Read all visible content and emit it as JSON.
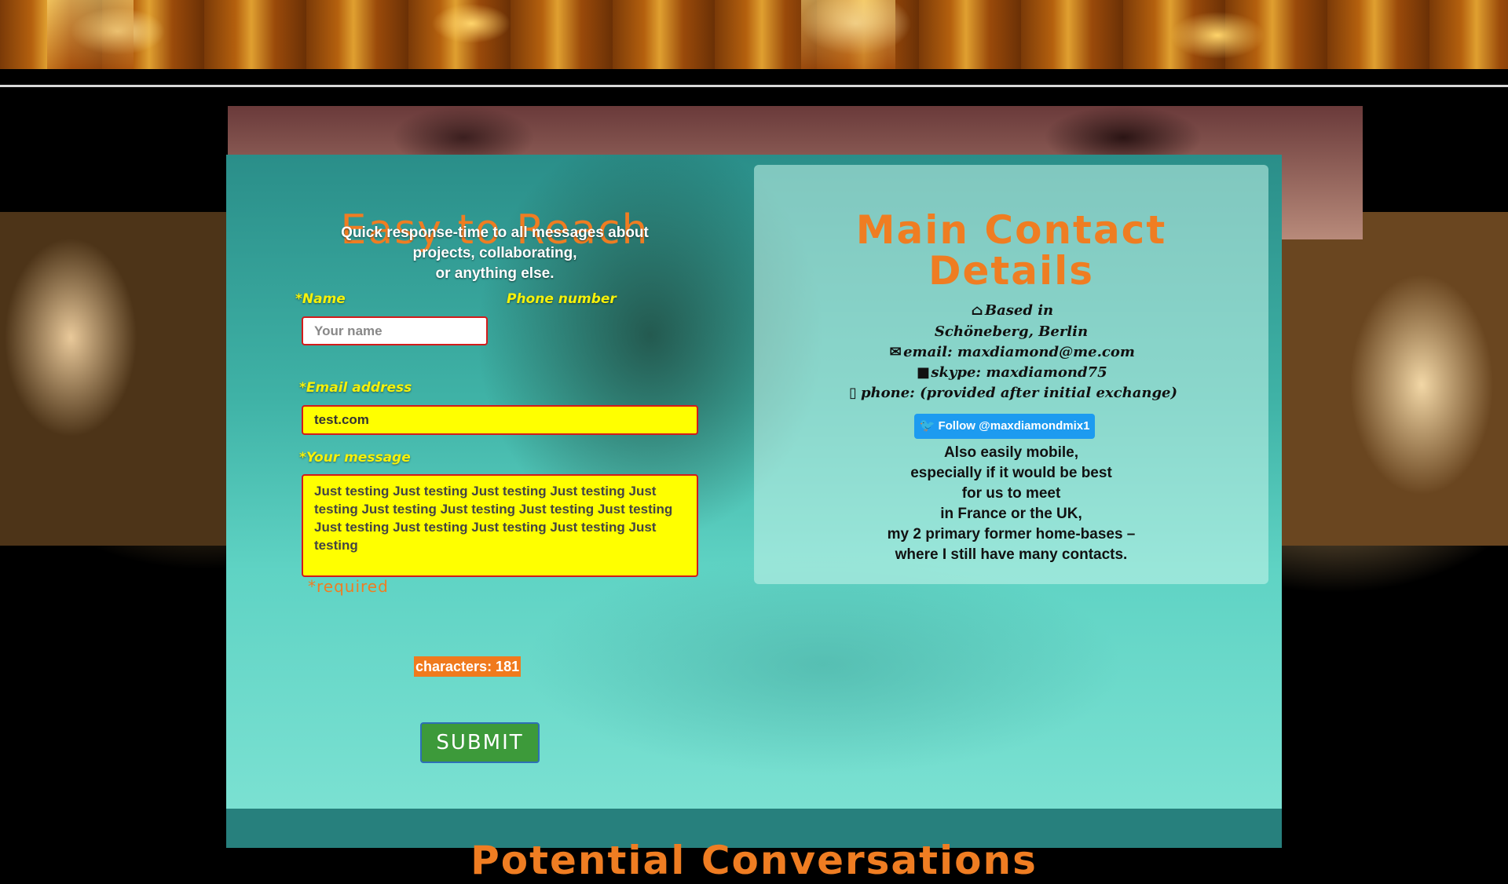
{
  "left": {
    "title": "Easy to Reach",
    "tagline": [
      "Quick response-time to all messages about",
      "projects, collaborating,",
      "or anything else."
    ],
    "name_label": "*Name",
    "name_placeholder": "Your name",
    "phone_label": "Phone number",
    "email_label": "*Email address",
    "email_value": "test.com",
    "message_label": "*Your message",
    "message_value": "Just testing Just testing Just testing Just testing Just testing Just testing Just testing Just testing Just testing Just testing Just testing Just testing Just testing Just testing",
    "required": "*required",
    "char_count": "characters: 181",
    "submit": "SUBMIT"
  },
  "right": {
    "title_line1": "Main Contact",
    "title_line2": "Details",
    "based_in": "Based in",
    "location": "Schöneberg, Berlin",
    "email": "email: maxdiamond@me.com",
    "skype": "skype: maxdiamond75",
    "phone": "phone: (provided after initial exchange)",
    "twitter": "Follow @maxdiamondmix1",
    "mobile_text": [
      "Also easily mobile,",
      "especially if it would be best",
      "for us to meet",
      "in France or the UK,",
      "my 2 primary former home-bases –",
      "where I still have many contacts."
    ]
  },
  "bottom_title": "Potential Conversations",
  "colors": {
    "accent": "#ef7d22",
    "label_yellow": "#f6f20a",
    "field_yellow": "#ffff00",
    "panel_teal": "#3fb2a6",
    "twitter_blue": "#1d9bf0",
    "submit_green": "#3d9a3a"
  },
  "icons": {
    "home": "home-icon",
    "mail": "envelope-icon",
    "video": "video-camera-icon",
    "phone": "mobile-phone-icon",
    "twitter": "twitter-bird-icon"
  }
}
